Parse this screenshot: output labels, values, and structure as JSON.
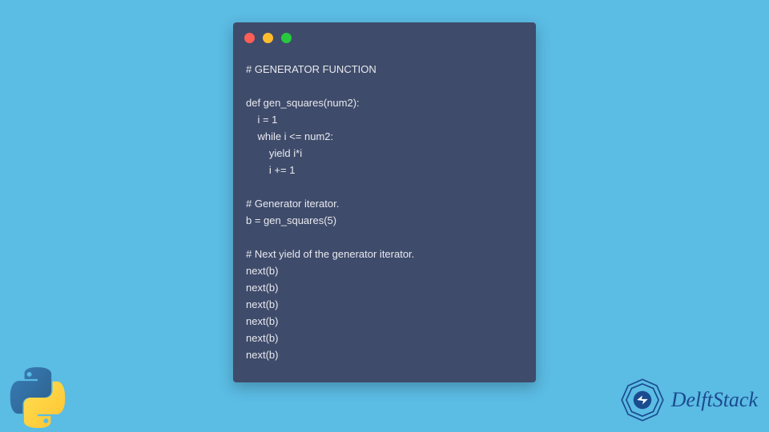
{
  "code_lines": [
    "# GENERATOR FUNCTION",
    "",
    "def gen_squares(num2):",
    "    i = 1",
    "    while i <= num2:",
    "        yield i*i",
    "        i += 1",
    "",
    "# Generator iterator.",
    "b = gen_squares(5)",
    "",
    "# Next yield of the generator iterator.",
    "next(b)",
    "next(b)",
    "next(b)",
    "next(b)",
    "next(b)",
    "next(b)"
  ],
  "brand": {
    "name": "DelftStack"
  },
  "colors": {
    "bg": "#5bbce4",
    "window": "#3f4b6a",
    "text": "#e8eaf0",
    "brand": "#1a4b8f"
  }
}
